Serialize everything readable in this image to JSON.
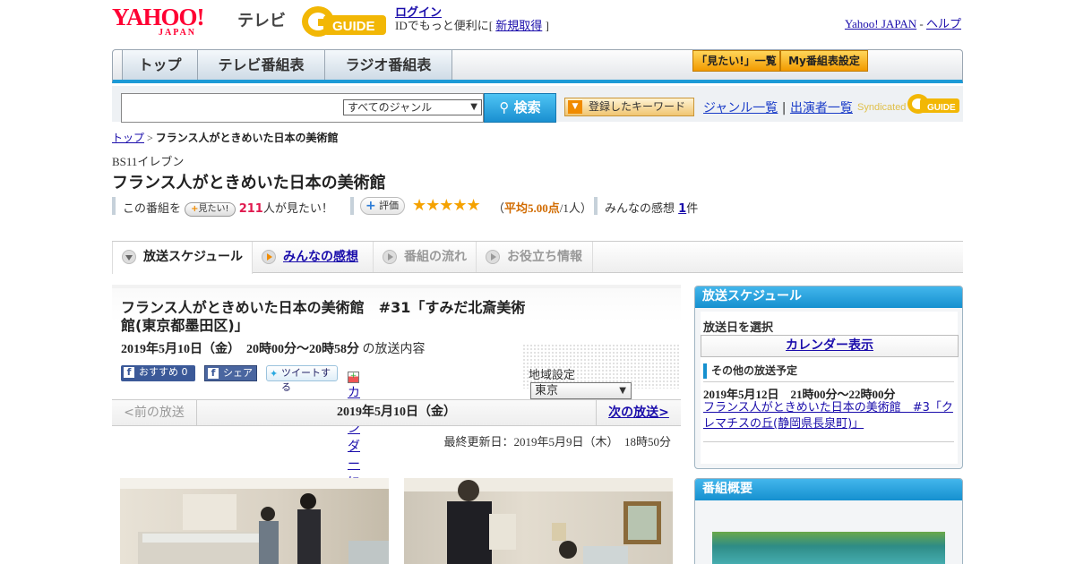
{
  "header": {
    "logo_text": "YAHOO!",
    "logo_sub": "JAPAN",
    "section": "テレビ",
    "login_label": "ログイン",
    "login_note_prefix": "IDでもっと便利に[",
    "signup_label": "新規取得",
    "login_note_suffix": "]",
    "yahoo_japan_link": "Yahoo! JAPAN",
    "separator": "-",
    "help_link": "ヘルプ"
  },
  "nav": {
    "tabs": [
      {
        "label": "トップ"
      },
      {
        "label": "テレビ番組表"
      },
      {
        "label": "ラジオ番組表"
      }
    ],
    "mitai_list": "「見たい!」一覧",
    "my_bangumi": "My番組表設定"
  },
  "search": {
    "input_value": "",
    "genre_selected": "すべてのジャンル",
    "search_button": "検索",
    "keyword_button": "登録したキーワード",
    "genre_list_link": "ジャンル一覧",
    "divider": "|",
    "performer_list_link": "出演者一覧",
    "syndicated_label": "Syndicated"
  },
  "breadcrumb": {
    "top": "トップ",
    "separator": ">",
    "current": "フランス人がときめいた日本の美術館"
  },
  "program": {
    "channel": "BS11イレブン",
    "title": "フランス人がときめいた日本の美術館",
    "mitai_prefix": "この番組を",
    "mitai_button": "見たい!",
    "mitai_count": "211",
    "mitai_suffix": "人が見たい！",
    "rating_button": "評価",
    "stars": "★★★★★",
    "rating_open": "（",
    "rating_avg": "平均5.00点",
    "rating_count": "/1人）",
    "kansou_prefix": "みんなの感想",
    "kansou_count": "1",
    "kansou_suffix": "件"
  },
  "tabs": {
    "schedule": "放送スケジュール",
    "kansou": "みんなの感想",
    "flow": "番組の流れ",
    "info": "お役立ち情報"
  },
  "episode": {
    "title": "フランス人がときめいた日本の美術館　#31「すみだ北斎美術館(東京都墨田区)」",
    "datetime": "2019年5月10日（金）　20時00分～20時58分",
    "datetime_suffix": "の放送内容",
    "fb_recommend": "おすすめ 0",
    "fb_share": "シェア",
    "tweet": "ツイートする",
    "calendar_register": "カレンダーに登録",
    "region_label": "地域設定",
    "region_selected": "東京"
  },
  "pager": {
    "prev": "<前の放送",
    "date": "2019年5月10日（金）",
    "next": "次の放送>"
  },
  "updated": "最終更新日：2019年5月9日（木）　18時50分",
  "sidebar": {
    "schedule_title": "放送スケジュール",
    "date_select_label": "放送日を選択",
    "calendar_button": "カレンダー表示",
    "other_label": "その他の放送予定",
    "other_date": "2019年5月12日　21時00分～22時00分",
    "other_link": "フランス人がときめいた日本の美術館　#3「クレマチスの丘(静岡県長泉町)」",
    "overview_title": "番組概要"
  },
  "colors": {
    "brand_red": "#ff0033",
    "accent_blue": "#1590cf",
    "star_gold": "#f5a200",
    "count_pink": "#e01a4f"
  }
}
